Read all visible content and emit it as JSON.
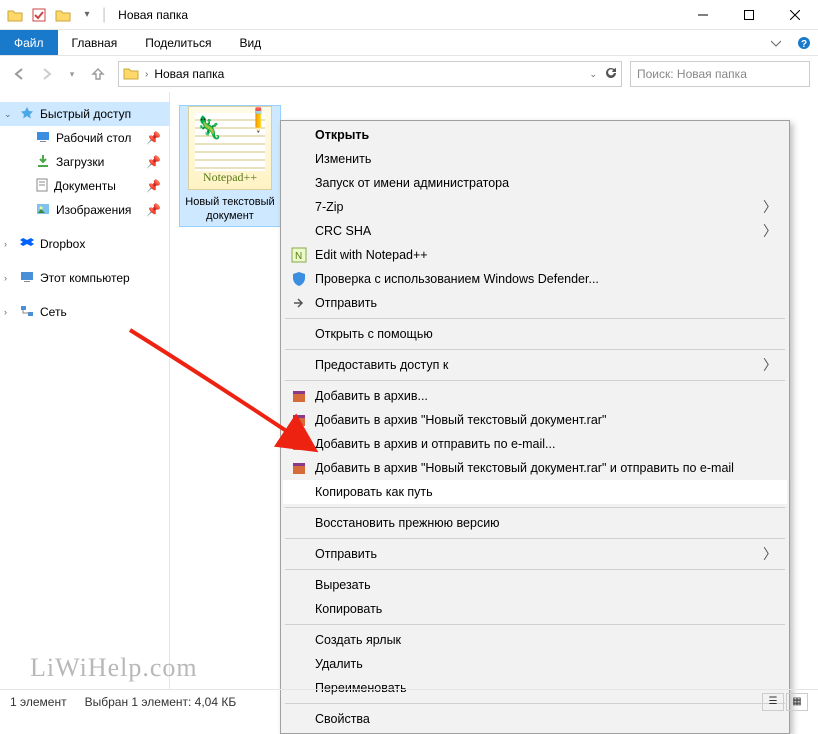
{
  "titlebar": {
    "folder_title": "Новая папка"
  },
  "ribbon": {
    "file": "Файл",
    "home": "Главная",
    "share": "Поделиться",
    "view": "Вид"
  },
  "address": {
    "crumb": "Новая папка",
    "search_placeholder": "Поиск: Новая папка"
  },
  "sidebar": {
    "quick_access": "Быстрый доступ",
    "items": [
      {
        "label": "Рабочий стол"
      },
      {
        "label": "Загрузки"
      },
      {
        "label": "Документы"
      },
      {
        "label": "Изображения"
      }
    ],
    "dropbox": "Dropbox",
    "this_pc": "Этот компьютер",
    "network": "Сеть"
  },
  "file": {
    "brand": "Notepad++",
    "label_line1": "Новый текстовый",
    "label_line2": "документ"
  },
  "context_menu": {
    "open": "Открыть",
    "edit": "Изменить",
    "run_as_admin": "Запуск от имени администратора",
    "sevenzip": "7-Zip",
    "crc_sha": "CRC SHA",
    "edit_npp": "Edit with Notepad++",
    "defender": "Проверка с использованием Windows Defender...",
    "send": "Отправить",
    "open_with": "Открыть с помощью",
    "grant_access": "Предоставить доступ к",
    "add_archive": "Добавить в архив...",
    "add_archive_named": "Добавить в архив \"Новый текстовый документ.rar\"",
    "add_archive_email": "Добавить в архив и отправить по e-mail...",
    "add_archive_named_email": "Добавить в архив \"Новый текстовый документ.rar\" и отправить по e-mail",
    "copy_as_path": "Копировать как путь",
    "restore_previous": "Восстановить прежнюю версию",
    "send_to": "Отправить",
    "cut": "Вырезать",
    "copy": "Копировать",
    "create_shortcut": "Создать ярлык",
    "delete": "Удалить",
    "rename": "Переименовать",
    "properties": "Свойства"
  },
  "statusbar": {
    "count": "1 элемент",
    "selection": "Выбран 1 элемент: 4,04 КБ"
  },
  "watermark": "LiWiHelp.com"
}
